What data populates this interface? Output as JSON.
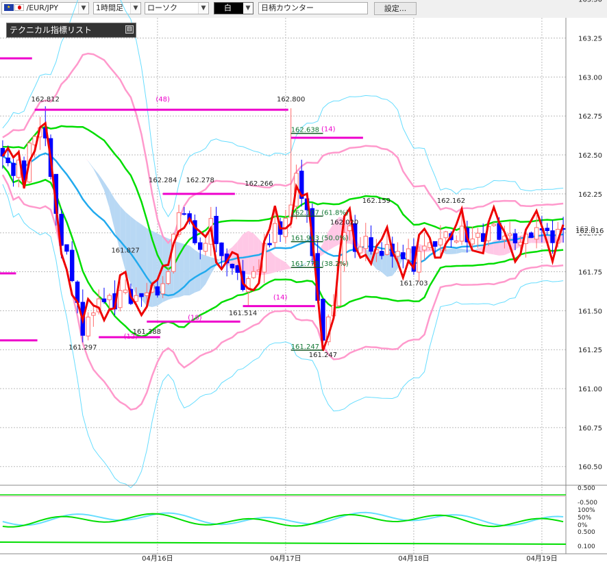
{
  "toolbar": {
    "symbol": "/EUR/JPY",
    "timeframe": "1時間足",
    "chart_style": "ローソク",
    "color_label": "白",
    "symbol_counter": "日柄カウンター",
    "settings_label": "設定..."
  },
  "indicator_panel": {
    "title": "テクニカル指標リスト",
    "toggle": "⊟"
  },
  "colors": {
    "candle_up": "#ff6a6a",
    "candle_down": "#0000ff",
    "sma_red": "#ee0000",
    "bb_green": "#00dd00",
    "bb_pink": "#ff99cc",
    "bb_cyan": "#66ddff",
    "mid_blue": "#22aaee",
    "magenta": "#ee00cc",
    "cloud_pink": "#ffc8e6",
    "cloud_blue": "#b8d8f4"
  },
  "chart_data": {
    "type": "candlestick",
    "symbol": "EUR/JPY",
    "ylim": [
      160.38,
      163.38
    ],
    "y_ticks": [
      "163.25",
      "163.00",
      "162.75",
      "162.50",
      "162.25",
      "162.00",
      "161.75",
      "161.50",
      "161.25",
      "161.00",
      "160.75",
      "160.50"
    ],
    "y_tick_partial": "163.50",
    "current_price": "162.016",
    "current_price_overlay": "162.0",
    "x_date_labels": [
      "04月16日",
      "04月17日",
      "04月18日",
      "04月19日"
    ],
    "x_dates_at": [
      29,
      53,
      77,
      101
    ],
    "n_bars": 106,
    "price_labels": [
      {
        "text": "162.812",
        "bar": 8,
        "y": 162.83,
        "side": "above"
      },
      {
        "text": "161.297",
        "bar": 15,
        "y": 161.3,
        "side": "below"
      },
      {
        "text": "161.827",
        "bar": 23,
        "y": 161.86,
        "side": "above"
      },
      {
        "text": "161.388",
        "bar": 27,
        "y": 161.4,
        "side": "below"
      },
      {
        "text": "162.284",
        "bar": 30,
        "y": 162.31,
        "side": "above"
      },
      {
        "text": "162.278",
        "bar": 37,
        "y": 162.31,
        "side": "above"
      },
      {
        "text": "161.514",
        "bar": 45,
        "y": 161.52,
        "side": "below"
      },
      {
        "text": "162.266",
        "bar": 48,
        "y": 162.29,
        "side": "above"
      },
      {
        "text": "162.800",
        "bar": 54,
        "y": 162.83,
        "side": "above"
      },
      {
        "text": "161.247",
        "bar": 60,
        "y": 161.25,
        "side": "below"
      },
      {
        "text": "162.020",
        "bar": 64,
        "y": 162.04,
        "side": "above"
      },
      {
        "text": "162.159",
        "bar": 70,
        "y": 162.18,
        "side": "above"
      },
      {
        "text": "161.703",
        "bar": 77,
        "y": 161.71,
        "side": "below"
      },
      {
        "text": "162.162",
        "bar": 84,
        "y": 162.18,
        "side": "above"
      }
    ],
    "fib_levels": [
      {
        "text": "162.638",
        "value": 162.638
      },
      {
        "text": "162.107 (61.8%)",
        "value": 162.107
      },
      {
        "text": "161.943 (50.0%)",
        "value": 161.943
      },
      {
        "text": "161.778 (38.2%)",
        "value": 161.778
      },
      {
        "text": "161.247",
        "value": 161.247
      }
    ],
    "cycle_labels": [
      {
        "text": "(48)",
        "bar": 30,
        "y": 162.86
      },
      {
        "text": "(14)",
        "bar": 61,
        "y": 162.67
      },
      {
        "text": "(14)",
        "bar": 52,
        "y": 161.59
      },
      {
        "text": "(18)",
        "bar": 36,
        "y": 161.46
      },
      {
        "text": "(12)",
        "bar": 24,
        "y": 161.34
      }
    ],
    "magenta_lines": [
      {
        "from": -1,
        "to": 5.5,
        "y": 163.12
      },
      {
        "from": 6,
        "to": 53.5,
        "y": 162.79
      },
      {
        "from": 54,
        "to": 67.5,
        "y": 162.61
      },
      {
        "from": 30,
        "to": 43.5,
        "y": 162.25
      },
      {
        "from": -1,
        "to": 2.5,
        "y": 161.74
      },
      {
        "from": 45,
        "to": 58.5,
        "y": 161.53
      },
      {
        "from": 27,
        "to": 44.5,
        "y": 161.43
      },
      {
        "from": 18,
        "to": 29.5,
        "y": 161.33
      },
      {
        "from": -1,
        "to": 6.5,
        "y": 161.31
      }
    ],
    "subpanel": {
      "labels": [
        "0.500",
        "-0.500",
        "100%",
        "50%",
        "0%",
        "0.500",
        "0.100"
      ]
    }
  }
}
